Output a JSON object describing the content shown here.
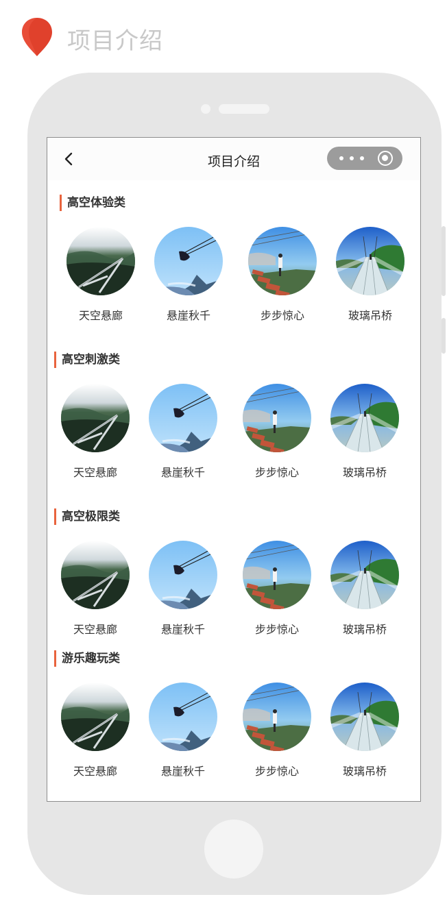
{
  "page_heading": "项目介绍",
  "nav": {
    "title": "项目介绍"
  },
  "sections": [
    {
      "title": "高空体验类",
      "items": [
        {
          "label": "天空悬廊",
          "icon": "sky-corridor-photo"
        },
        {
          "label": "悬崖秋千",
          "icon": "cliff-swing-photo"
        },
        {
          "label": "步步惊心",
          "icon": "step-plank-photo"
        },
        {
          "label": "玻璃吊桥",
          "icon": "glass-bridge-photo"
        }
      ]
    },
    {
      "title": "高空刺激类",
      "items": [
        {
          "label": "天空悬廊",
          "icon": "sky-corridor-photo"
        },
        {
          "label": "悬崖秋千",
          "icon": "cliff-swing-photo"
        },
        {
          "label": "步步惊心",
          "icon": "step-plank-photo"
        },
        {
          "label": "玻璃吊桥",
          "icon": "glass-bridge-photo"
        }
      ]
    },
    {
      "title": "高空极限类",
      "items": [
        {
          "label": "天空悬廊",
          "icon": "sky-corridor-photo"
        },
        {
          "label": "悬崖秋千",
          "icon": "cliff-swing-photo"
        },
        {
          "label": "步步惊心",
          "icon": "step-plank-photo"
        },
        {
          "label": "玻璃吊桥",
          "icon": "glass-bridge-photo"
        }
      ]
    },
    {
      "title": "游乐趣玩类",
      "items": [
        {
          "label": "天空悬廊",
          "icon": "sky-corridor-photo"
        },
        {
          "label": "悬崖秋千",
          "icon": "cliff-swing-photo"
        },
        {
          "label": "步步惊心",
          "icon": "step-plank-photo"
        },
        {
          "label": "玻璃吊桥",
          "icon": "glass-bridge-photo"
        }
      ]
    }
  ],
  "colors": {
    "accent": "#e8633d",
    "pin": "#e0412c",
    "device": "#e6e6e6",
    "capsule": "#9c9c9c"
  }
}
